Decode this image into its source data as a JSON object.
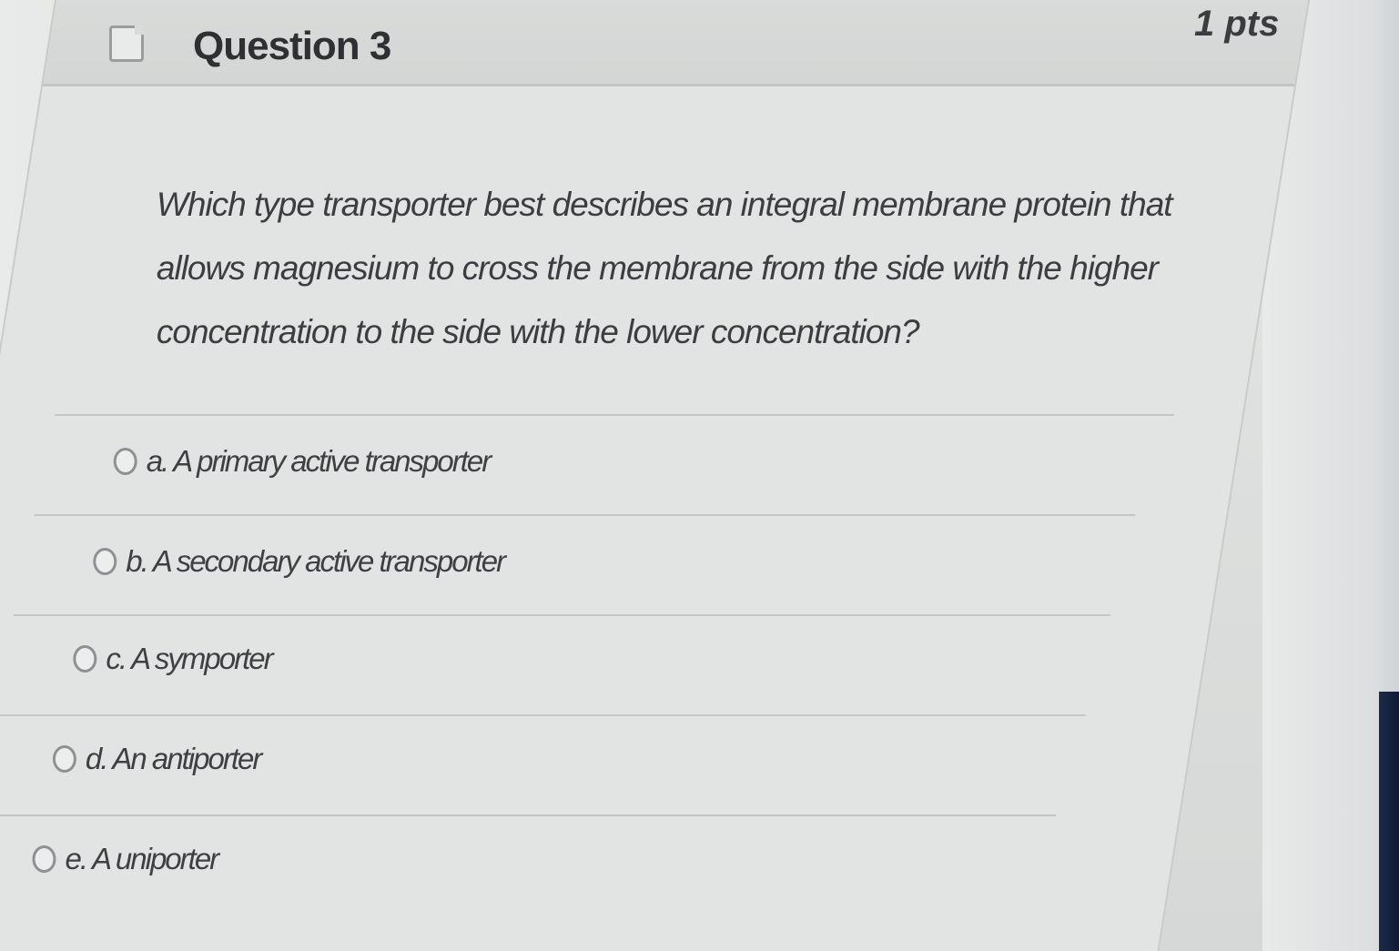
{
  "question": {
    "title": "Question 3",
    "points": "1 pts",
    "text": "Which type transporter best describes an integral membrane protein that allows magnesium to cross the membrane from the side with the higher concentration to the side with the lower concentration?"
  },
  "answers": [
    {
      "label": "a. A primary active transporter"
    },
    {
      "label": "b. A secondary active transporter"
    },
    {
      "label": "c. A symporter"
    },
    {
      "label": "d. An antiporter"
    },
    {
      "label": "e. A uniporter"
    }
  ],
  "colors": {
    "text": "#3a3b3d",
    "card_background": "#e2e4e3",
    "header_background": "#d7d9d8",
    "divider": "#c5c7c7"
  }
}
